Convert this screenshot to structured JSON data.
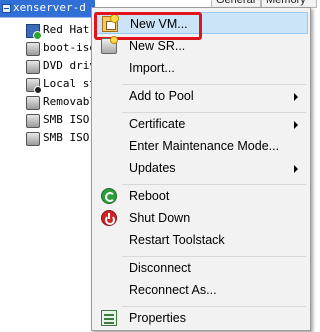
{
  "tree": {
    "root_label": "xenserver-d",
    "tabs": {
      "general": "General",
      "memory": "Memory"
    },
    "items": [
      {
        "label": "Red Hat",
        "icon": "vm-running-icon"
      },
      {
        "label": "boot-iso",
        "icon": "disk-icon"
      },
      {
        "label": "DVD driv",
        "icon": "disk-icon"
      },
      {
        "label": "Local st",
        "icon": "storage-default-icon"
      },
      {
        "label": "Removabl",
        "icon": "disk-icon"
      },
      {
        "label": "SMB ISO",
        "icon": "disk-icon"
      },
      {
        "label": "SMB ISO",
        "icon": "disk-icon"
      }
    ]
  },
  "menu": {
    "new_vm": "New VM...",
    "new_sr": "New SR...",
    "import": "Import...",
    "add_to_pool": "Add to Pool",
    "certificate": "Certificate",
    "enter_maintenance": "Enter Maintenance Mode...",
    "updates": "Updates",
    "reboot": "Reboot",
    "shut_down": "Shut Down",
    "restart_toolstack": "Restart Toolstack",
    "disconnect": "Disconnect",
    "reconnect_as": "Reconnect As...",
    "properties": "Properties"
  },
  "colors": {
    "highlight": "#cce4f7",
    "focus_ring": "#e0141c",
    "tree_selected": "#2f6fd6"
  }
}
